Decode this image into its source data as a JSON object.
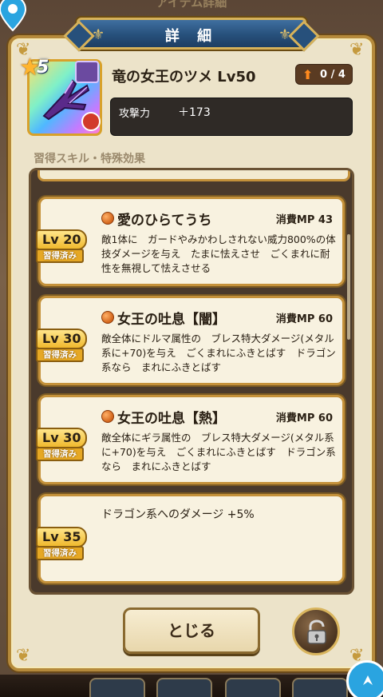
{
  "backdrop": {
    "title": "アイテム詳細"
  },
  "dialog": {
    "title": "詳 細"
  },
  "item": {
    "rarity": "5",
    "name": "竜の女王のツメ Lv50",
    "upgrade": "0 / 4",
    "stat_label": "攻撃力",
    "stat_value": "＋173"
  },
  "section_heading": "習得スキル・特殊効果",
  "skills": [
    {
      "name": "愛のひらてうち",
      "mp": "消費MP 43",
      "level": "Lv 20",
      "learned": "習得済み",
      "desc": "敵1体に　ガードやみかわしされない威力800%の体技ダメージを与え　たまに怯えさせ　ごくまれに耐性を無視して怯えさせる"
    },
    {
      "name": "女王の吐息【闇】",
      "mp": "消費MP 60",
      "level": "Lv 30",
      "learned": "習得済み",
      "desc": "敵全体にドルマ属性の　ブレス特大ダメージ(メタル系に+70)を与え　ごくまれにふきとばす　ドラゴン系なら　まれにふきとばす"
    },
    {
      "name": "女王の吐息【熱】",
      "mp": "消費MP 60",
      "level": "Lv 30",
      "learned": "習得済み",
      "desc": "敵全体にギラ属性の　ブレス特大ダメージ(メタル系に+70)を与え　ごくまれにふきとばす　ドラゴン系なら　まれにふきとばす"
    },
    {
      "desc": "ドラゴン系へのダメージ +5%",
      "level": "Lv 35",
      "learned": "習得済み"
    }
  ],
  "buttons": {
    "close": "とじる"
  },
  "colors": {
    "frame_gold": "#c4913a",
    "banner_blue": "#27507b",
    "card_bg": "#f8f2e0",
    "level_tag": "#f0b92e"
  },
  "icons": [
    "map-pin-icon",
    "compass-icon",
    "star-icon",
    "skill-orb-icon",
    "lock-icon",
    "up-arrow-icon"
  ]
}
